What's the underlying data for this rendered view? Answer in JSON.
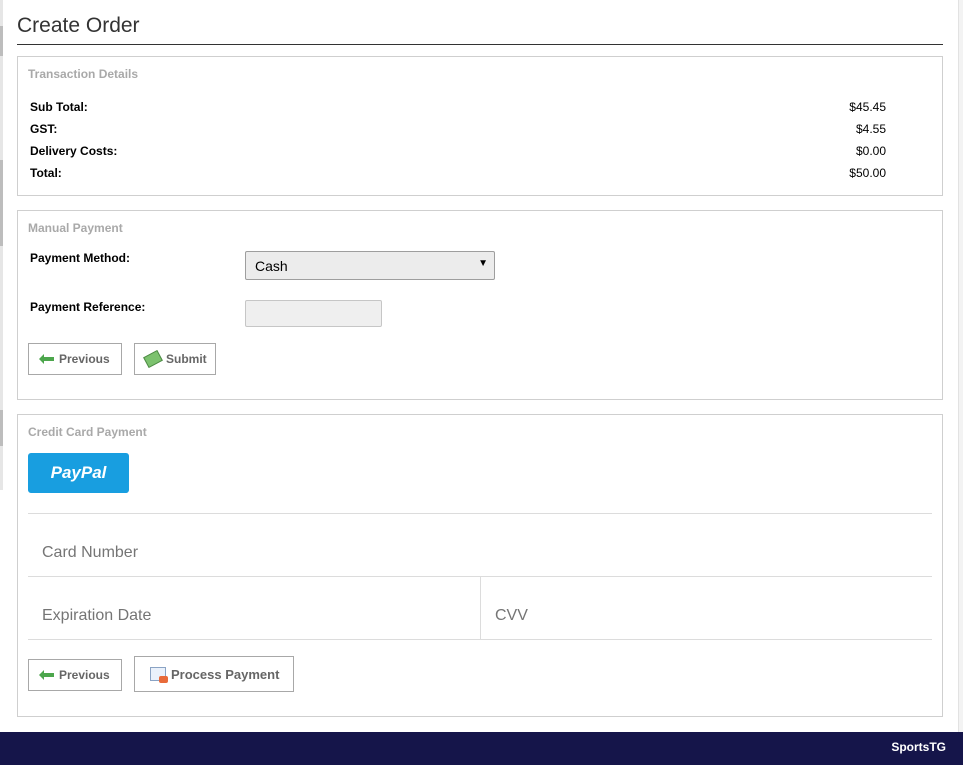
{
  "page": {
    "title": "Create Order"
  },
  "transaction": {
    "legend": "Transaction Details",
    "rows": [
      {
        "label": "Sub Total:",
        "value": "$45.45"
      },
      {
        "label": "GST:",
        "value": "$4.55"
      },
      {
        "label": "Delivery Costs:",
        "value": "$0.00"
      },
      {
        "label": "Total:",
        "value": "$50.00"
      }
    ]
  },
  "manual": {
    "legend": "Manual Payment",
    "method_label": "Payment Method:",
    "method_value": "Cash",
    "reference_label": "Payment Reference:",
    "reference_value": "",
    "previous_label": "Previous",
    "submit_label": "Submit"
  },
  "credit": {
    "legend": "Credit Card Payment",
    "paypal_label": "PayPal",
    "card_number_placeholder": "Card Number",
    "expiration_placeholder": "Expiration Date",
    "cvv_placeholder": "CVV",
    "previous_label": "Previous",
    "process_label": "Process Payment"
  },
  "footer": {
    "brand": "SportsTG",
    "background": "#15154a"
  },
  "colors": {
    "paypal": "#189ee0",
    "legend": "#a9a9a9"
  },
  "icons": {
    "previous": "arrow-left-icon",
    "submit": "money-icon",
    "process": "credit-card-icon"
  }
}
